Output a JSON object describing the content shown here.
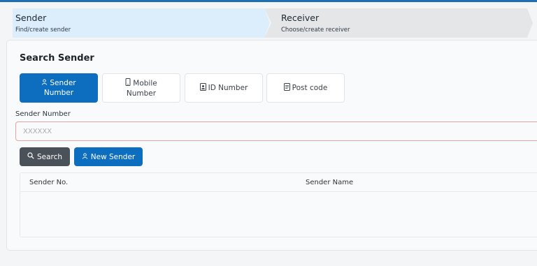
{
  "stepper": {
    "steps": [
      {
        "title": "Sender",
        "subtitle": "Find/create sender",
        "active": true
      },
      {
        "title": "Receiver",
        "subtitle": "Choose/create receiver",
        "active": false
      }
    ]
  },
  "search_panel": {
    "title": "Search Sender",
    "tiles": [
      {
        "line1": "Sender",
        "line2": "Number",
        "icon": "user-icon",
        "active": true
      },
      {
        "line1": "Mobile",
        "line2": "Number",
        "icon": "mobile-icon",
        "active": false
      },
      {
        "label": "ID Number",
        "icon": "id-card-icon",
        "active": false
      },
      {
        "label": "Post code",
        "icon": "document-icon",
        "active": false
      }
    ],
    "field": {
      "label": "Sender Number",
      "placeholder": "XXXXXX",
      "value": ""
    },
    "buttons": {
      "search": "Search",
      "new_sender": "New Sender"
    },
    "table": {
      "columns": [
        "Sender No.",
        "Sender Name"
      ],
      "rows": []
    }
  },
  "colors": {
    "primary": "#0d6ec0",
    "secondary": "#4a5159",
    "active_step": "#dceefc",
    "inactive_step": "#e5e6e8",
    "input_error_border": "#e6a3a3"
  }
}
